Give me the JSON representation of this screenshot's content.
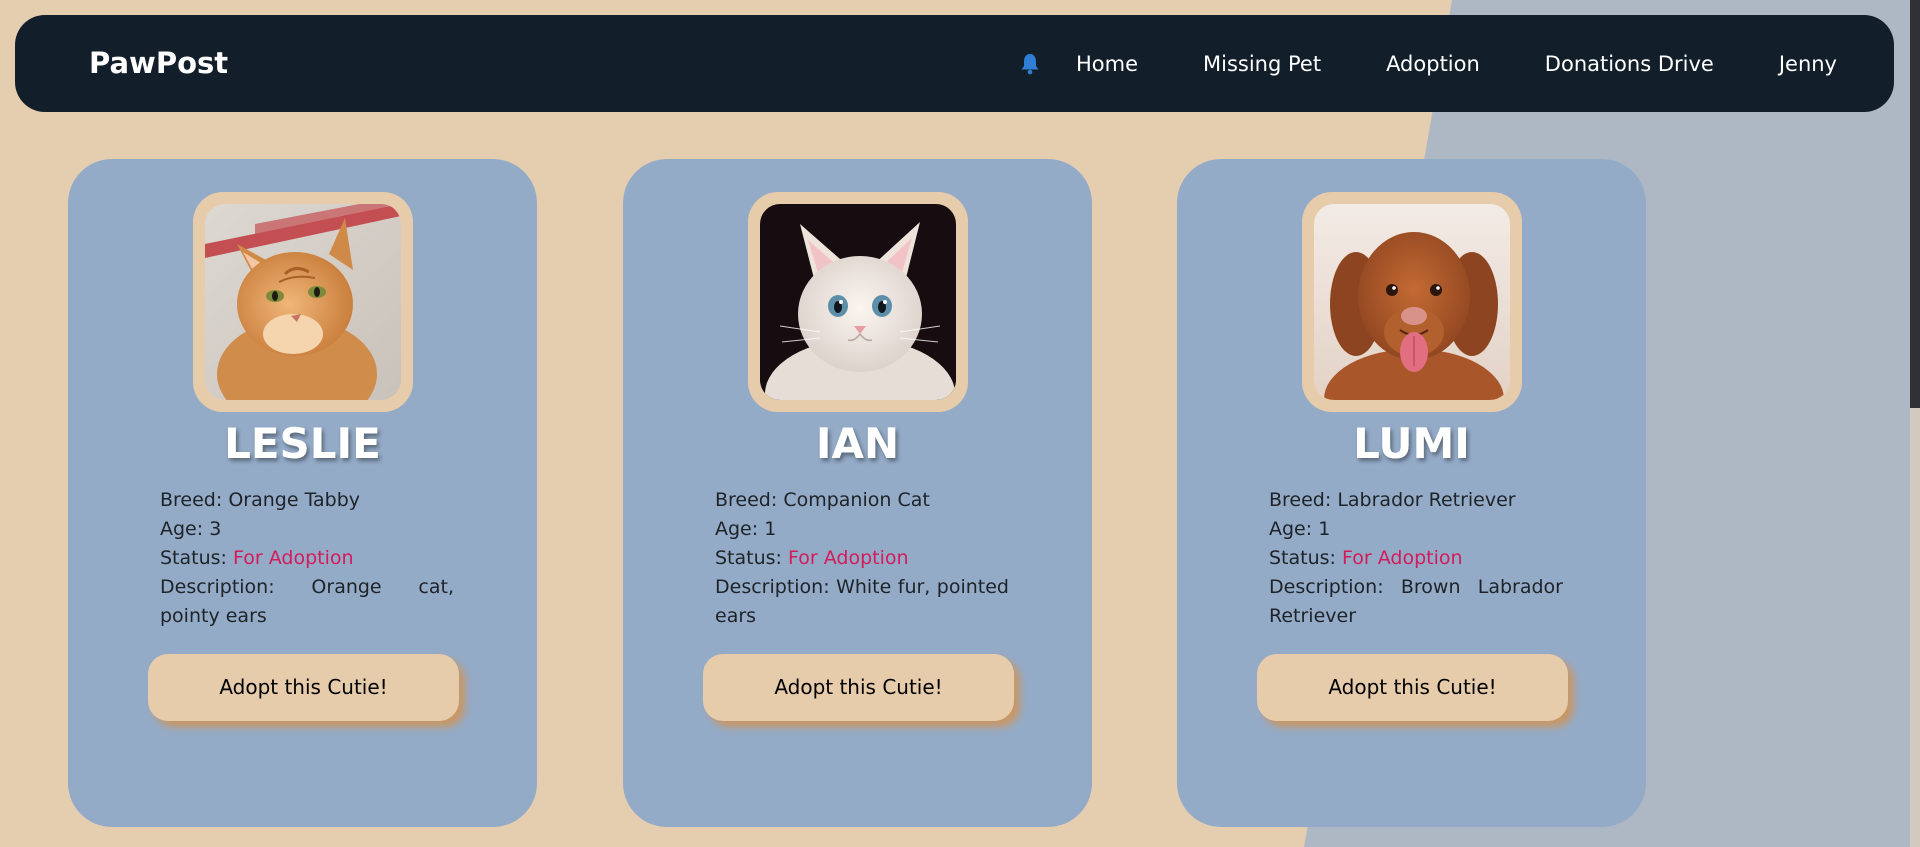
{
  "nav": {
    "brand": "PawPost",
    "links": [
      "Home",
      "Missing Pet",
      "Adoption",
      "Donations Drive",
      "Jenny"
    ]
  },
  "colors": {
    "navbar": "#121e29",
    "page_background": "#e5cdb0",
    "card": "#94abc8",
    "button": "#e7ccab",
    "status_accent": "#d31b5a",
    "bell": "#2f7fd4"
  },
  "icons": {
    "notifications": "bell-icon"
  },
  "pets": [
    {
      "name": "LESLIE",
      "breed_label": "Breed:",
      "breed": "Orange Tabby",
      "age_label": "Age:",
      "age": "3",
      "status_label": "Status:",
      "status": "For Adoption",
      "description_label": "Description:",
      "description": "Orange cat, pointy ears",
      "button": "Adopt this Cutie!",
      "photo": "orange tabby cat"
    },
    {
      "name": "IAN",
      "breed_label": "Breed:",
      "breed": "Companion Cat",
      "age_label": "Age:",
      "age": "1",
      "status_label": "Status:",
      "status": "For Adoption",
      "description_label": "Description:",
      "description": "White fur, pointed ears",
      "button": "Adopt this Cutie!",
      "photo": "white kitten"
    },
    {
      "name": "LUMI",
      "breed_label": "Breed:",
      "breed": "Labrador Retriever",
      "age_label": "Age:",
      "age": "1",
      "status_label": "Status:",
      "status": "For Adoption",
      "description_label": "Description:",
      "description": "Brown Labrador Retriever",
      "button": "Adopt this Cutie!",
      "photo": "brown retriever dog"
    }
  ]
}
